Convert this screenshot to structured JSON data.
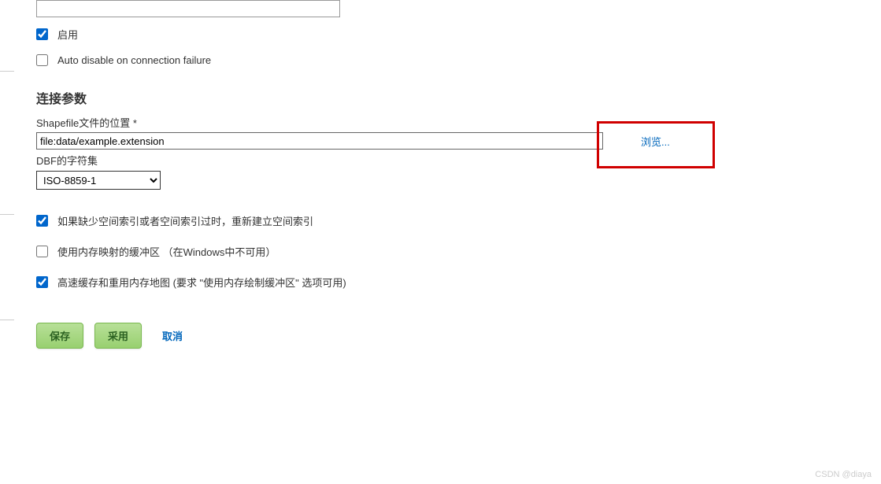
{
  "checkboxes": {
    "enable_label": "启用",
    "auto_disable_label": "Auto disable on connection failure"
  },
  "connection_section": {
    "title": "连接参数",
    "shapefile_label": "Shapefile文件的位置 *",
    "shapefile_value": "file:data/example.extension",
    "browse_label": "浏览...",
    "dbf_charset_label": "DBF的字符集",
    "dbf_charset_value": "ISO-8859-1"
  },
  "options": {
    "rebuild_index_label": "如果缺少空间索引或者空间索引过时，重新建立空间索引",
    "memory_mapped_label": "使用内存映射的缓冲区 （在Windows中不可用）",
    "cache_reuse_label": "高速缓存和重用内存地图 (要求 \"使用内存绘制缓冲区\" 选项可用)"
  },
  "buttons": {
    "save": "保存",
    "apply": "采用",
    "cancel": "取消"
  },
  "watermark": "CSDN @diaya"
}
